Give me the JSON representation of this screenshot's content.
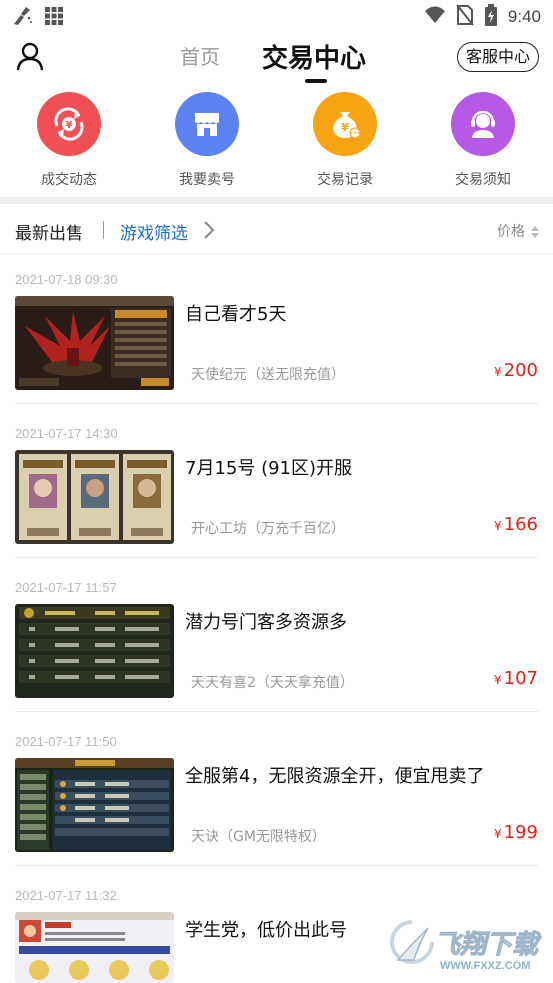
{
  "status_bar": {
    "time": "9:40"
  },
  "header": {
    "tab_home": "首页",
    "tab_trade": "交易中心",
    "customer_service": "客服中心"
  },
  "quick_actions": [
    {
      "label": "成交动态",
      "icon": "exchange-yen-icon",
      "color": "#f04f55"
    },
    {
      "label": "我要卖号",
      "icon": "shop-icon",
      "color": "#5b82ef"
    },
    {
      "label": "交易记录",
      "icon": "money-bag-icon",
      "color": "#f7a412"
    },
    {
      "label": "交易须知",
      "icon": "support-agent-icon",
      "color": "#b65ae6"
    }
  ],
  "filter_bar": {
    "latest": "最新出售",
    "game_filter": "游戏筛选",
    "price": "价格"
  },
  "listings": [
    {
      "date": "2021-07-18 09:30",
      "title": "自己看才5天",
      "game": "天使纪元（送无限充值）",
      "currency": "¥",
      "price": "200",
      "thumb": "game-screenshot-red-dragon"
    },
    {
      "date": "2021-07-17 14:30",
      "title": "7月15号 (91区)开服",
      "game": "开心工坊（万充千百亿）",
      "currency": "¥",
      "price": "166",
      "thumb": "game-screenshot-character-cards"
    },
    {
      "date": "2021-07-17 11:57",
      "title": "潜力号门客多资源多",
      "game": "天天有喜2（天天拿充值）",
      "currency": "¥",
      "price": "107",
      "thumb": "game-screenshot-ranking-table"
    },
    {
      "date": "2021-07-17 11:50",
      "title": "全服第4，无限资源全开，便宜甩卖了",
      "game": "天诀（GM无限特权）",
      "currency": "¥",
      "price": "199",
      "thumb": "game-screenshot-leaderboard"
    },
    {
      "date": "2021-07-17 11:32",
      "title": "学生党，低价出此号",
      "game": "",
      "currency": "",
      "price": "",
      "thumb": "game-screenshot-event-panel"
    }
  ],
  "watermark": {
    "text": "飞翔下载",
    "url": "WWW.FXXZ.COM"
  }
}
